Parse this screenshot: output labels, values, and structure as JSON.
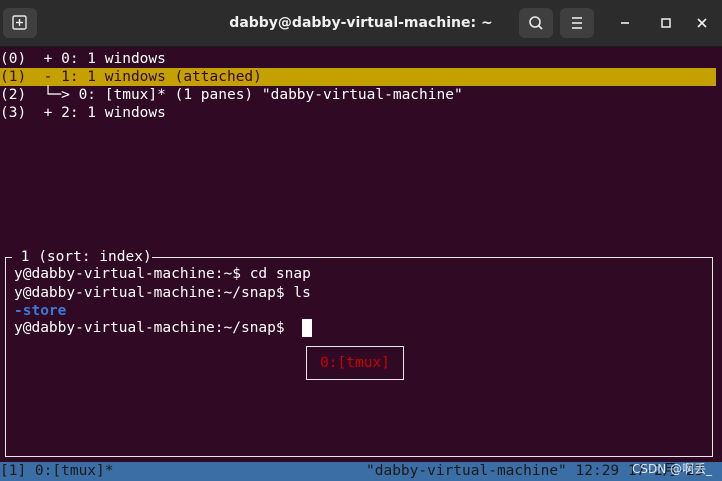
{
  "window": {
    "title": "dabby@dabby-virtual-machine: ~"
  },
  "icons": {
    "new_tab": "new-tab-icon",
    "search": "search-icon",
    "menu": "hamburger-menu-icon",
    "minimize": "minimize-icon",
    "maximize": "maximize-icon",
    "close": "close-icon"
  },
  "tree": {
    "rows": [
      "(0)  + 0: 1 windows",
      "(1)  - 1: 1 windows (attached)",
      "(2)  └─> 0: [tmux]* (1 panes) \"dabby-virtual-machine\"",
      "(3)  + 2: 1 windows"
    ],
    "selected_row_color": "#c4a000"
  },
  "preview": {
    "caption": " 1 (sort: index)",
    "lines": [
      "y@dabby-virtual-machine:~$ cd snap",
      "y@dabby-virtual-machine:~/snap$ ls",
      "-store",
      "y@dabby-virtual-machine:~/snap$ "
    ],
    "pane_label": "0:[tmux]"
  },
  "status": {
    "left": "[1] 0:[tmux]*",
    "right": "\"dabby-virtual-machine\" 12:29 17-2月-23"
  },
  "watermark": "CSDN @啊丢_",
  "colors": {
    "terminal_bg": "#300a24",
    "status_bar": "#3a6ea5",
    "pane_label": "#cc0000",
    "ls_dir": "#3b78d8"
  }
}
